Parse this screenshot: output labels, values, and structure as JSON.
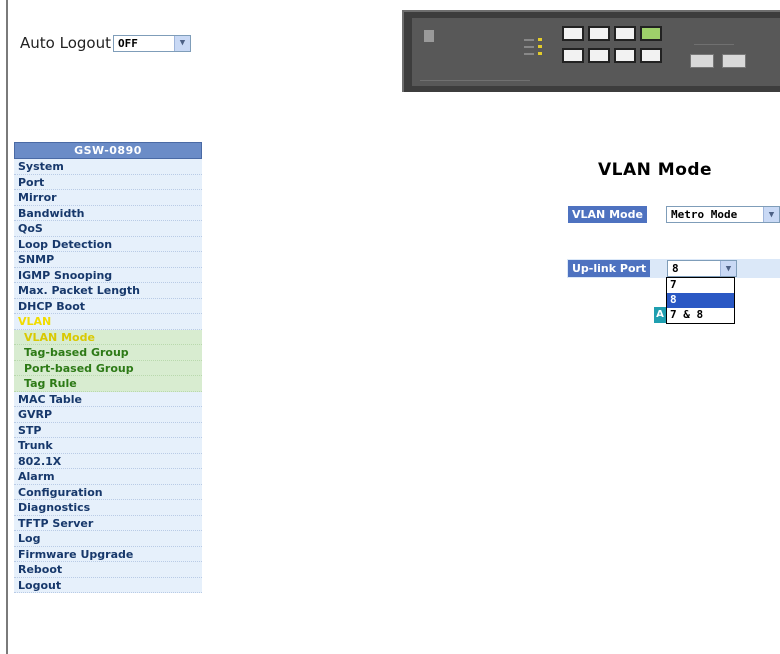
{
  "auto_logout": {
    "label": "Auto Logout",
    "value": "OFF"
  },
  "menu": {
    "header": "GSW-0890",
    "items": [
      {
        "label": "System"
      },
      {
        "label": "Port"
      },
      {
        "label": "Mirror"
      },
      {
        "label": "Bandwidth"
      },
      {
        "label": "QoS"
      },
      {
        "label": "Loop Detection"
      },
      {
        "label": "SNMP"
      },
      {
        "label": "IGMP Snooping"
      },
      {
        "label": "Max. Packet Length"
      },
      {
        "label": "DHCP Boot"
      },
      {
        "label": "VLAN"
      },
      {
        "label": "VLAN Mode"
      },
      {
        "label": "Tag-based Group"
      },
      {
        "label": "Port-based Group"
      },
      {
        "label": "Tag Rule"
      },
      {
        "label": "MAC Table"
      },
      {
        "label": "GVRP"
      },
      {
        "label": "STP"
      },
      {
        "label": "Trunk"
      },
      {
        "label": "802.1X"
      },
      {
        "label": "Alarm"
      },
      {
        "label": "Configuration"
      },
      {
        "label": "Diagnostics"
      },
      {
        "label": "TFTP Server"
      },
      {
        "label": "Log"
      },
      {
        "label": "Firmware Upgrade"
      },
      {
        "label": "Reboot"
      },
      {
        "label": "Logout"
      }
    ]
  },
  "content": {
    "title": "VLAN Mode",
    "vlan_mode": {
      "label": "VLAN Mode",
      "value": "Metro Mode"
    },
    "uplink_port": {
      "label": "Up-link Port",
      "value": "8",
      "options": [
        "7",
        "8",
        "7 & 8"
      ],
      "highlighted": "8"
    },
    "apply_label": "A"
  },
  "colors": {
    "menu_bg": "#e6f0fb",
    "menu_header": "#6b8cc7",
    "submenu_bg": "#d8ecd0",
    "label_bg": "#4e72c0",
    "active_yellow": "#f1dc00"
  }
}
